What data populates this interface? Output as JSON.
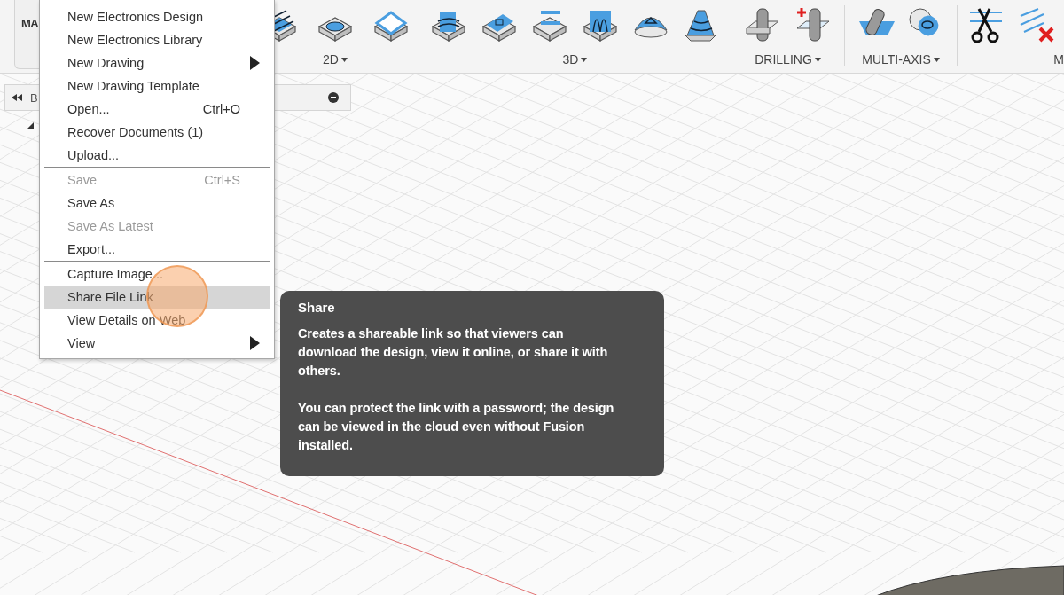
{
  "toolbar": {
    "workspace": {
      "label": "MA"
    },
    "groups": [
      {
        "kind": "planar",
        "label": "2D",
        "has_menu": true
      },
      {
        "kind": "surface",
        "label": "3D",
        "has_menu": true
      },
      {
        "kind": "drilling",
        "label": "DRILLING",
        "has_menu": true
      },
      {
        "kind": "multiaxis",
        "label": "MULTI-AXIS",
        "has_menu": true
      },
      {
        "kind": "modify",
        "label": "M",
        "has_menu": false
      }
    ]
  },
  "browser": {
    "title": "B"
  },
  "file_menu": {
    "items": [
      {
        "kind": "item",
        "label": "New Electronics Design",
        "disabled": false,
        "selected": false,
        "submenu": false
      },
      {
        "kind": "item",
        "label": "New Electronics Library",
        "disabled": false,
        "selected": false,
        "submenu": false
      },
      {
        "kind": "item",
        "label": "New Drawing",
        "disabled": false,
        "selected": false,
        "submenu": true
      },
      {
        "kind": "item",
        "label": "New Drawing Template",
        "disabled": false,
        "selected": false,
        "submenu": false
      },
      {
        "kind": "item",
        "label": "Open...",
        "shortcut": "Ctrl+O",
        "disabled": false,
        "selected": false,
        "submenu": false
      },
      {
        "kind": "item",
        "label": "Recover Documents (1)",
        "disabled": false,
        "selected": false,
        "submenu": false
      },
      {
        "kind": "item",
        "label": "Upload...",
        "disabled": false,
        "selected": false,
        "submenu": false
      },
      {
        "kind": "separator"
      },
      {
        "kind": "item",
        "label": "Save",
        "shortcut": "Ctrl+S",
        "disabled": true,
        "selected": false,
        "submenu": false
      },
      {
        "kind": "item",
        "label": "Save As",
        "disabled": false,
        "selected": false,
        "submenu": false
      },
      {
        "kind": "item",
        "label": "Save As Latest",
        "disabled": true,
        "selected": false,
        "submenu": false
      },
      {
        "kind": "item",
        "label": "Export...",
        "disabled": false,
        "selected": false,
        "submenu": false
      },
      {
        "kind": "separator"
      },
      {
        "kind": "item",
        "label": "Capture Image...",
        "disabled": false,
        "selected": false,
        "submenu": false
      },
      {
        "kind": "item",
        "label": "Share File Link",
        "disabled": false,
        "selected": true,
        "submenu": false
      },
      {
        "kind": "item",
        "label": "View Details on Web",
        "disabled": false,
        "selected": false,
        "submenu": false
      },
      {
        "kind": "item",
        "label": "View",
        "disabled": false,
        "selected": false,
        "submenu": true
      }
    ]
  },
  "tooltip": {
    "title": "Share",
    "paragraphs": [
      "Creates a shareable link so that viewers can download the design, view it online, or share it with others.",
      "You can protect the link with a password; the design can be viewed in the cloud even without Fusion installed."
    ]
  }
}
